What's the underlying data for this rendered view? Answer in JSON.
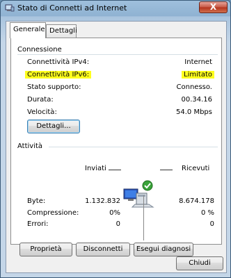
{
  "window": {
    "title": "Stato di Connetti ad Internet",
    "close_glyph": "X"
  },
  "tabs": [
    {
      "label": "Generale",
      "active": true
    },
    {
      "label": "Dettagli",
      "active": false
    }
  ],
  "connection": {
    "heading": "Connessione",
    "rows": [
      {
        "label": "Connettività IPv4:",
        "value": "Internet",
        "highlighted": false
      },
      {
        "label": "Connettività IPv6:",
        "value": "Limitato",
        "highlighted": true
      },
      {
        "label": "Stato supporto:",
        "value": "Connesso.",
        "highlighted": false
      },
      {
        "label": "Durata:",
        "value": "00.34.16",
        "highlighted": false
      },
      {
        "label": "Velocità:",
        "value": "54.0 Mbps",
        "highlighted": false
      }
    ],
    "details_button": "Dettagli..."
  },
  "activity": {
    "heading": "Attività",
    "sent_label": "Inviati",
    "received_label": "Ricevuti",
    "rows": [
      {
        "label": "Byte:",
        "sent": "1.132.832",
        "received": "8.674.178"
      },
      {
        "label": "Compressione:",
        "sent": "0%",
        "received": "0 %"
      },
      {
        "label": "Errori:",
        "sent": "0",
        "received": "0"
      }
    ]
  },
  "buttons": {
    "properties": "Proprietà",
    "disconnect": "Disconnetti",
    "diagnose": "Esegui diagnosi",
    "close": "Chiudi"
  },
  "colors": {
    "highlight": "#ffff1e",
    "close_button": "#c75743"
  },
  "icons": {
    "app": "network-connection-icon",
    "network": "network-computers-check-icon"
  }
}
